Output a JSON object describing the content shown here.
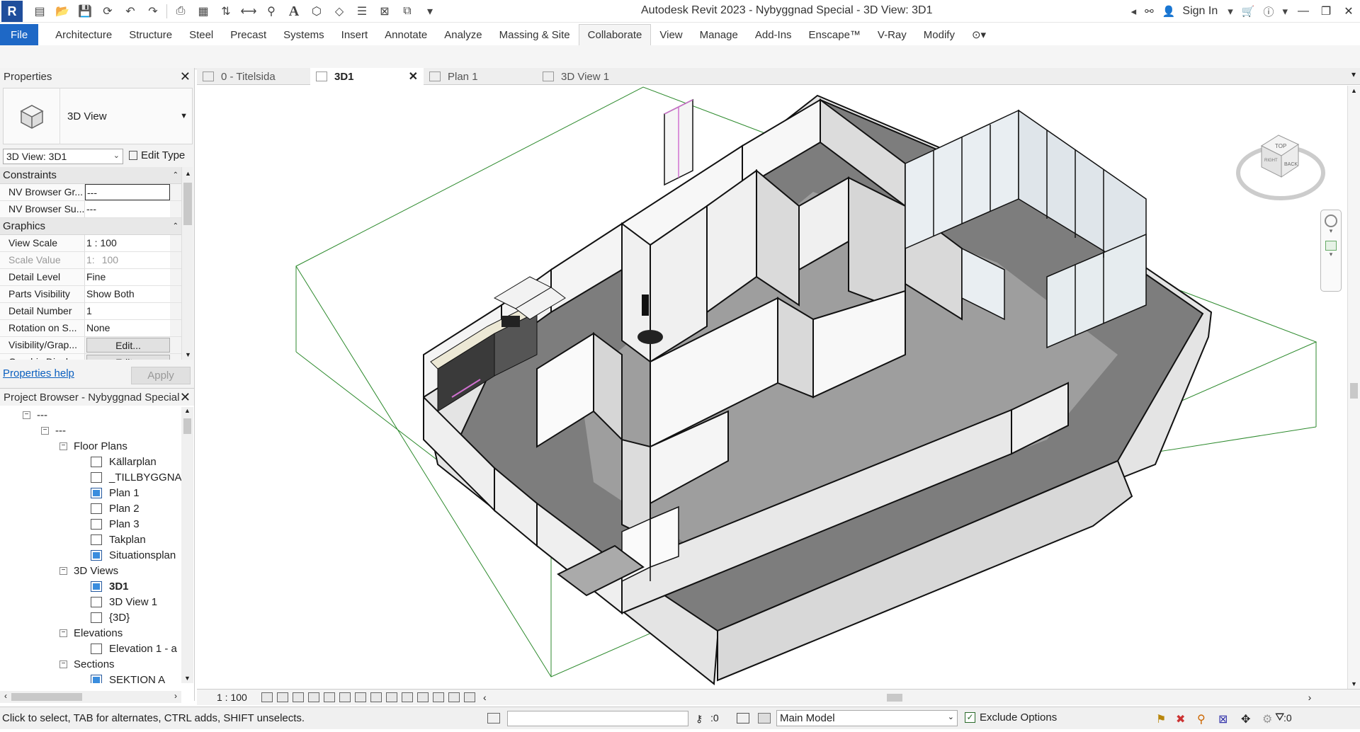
{
  "app": {
    "window_title": "Autodesk Revit 2023 - Nybyggnad Special - 3D View: 3D1",
    "logo_letter": "R",
    "sign_in": "Sign In"
  },
  "ribbon": {
    "tabs": [
      "File",
      "Architecture",
      "Structure",
      "Steel",
      "Precast",
      "Systems",
      "Insert",
      "Annotate",
      "Analyze",
      "Massing & Site",
      "Collaborate",
      "View",
      "Manage",
      "Add-Ins",
      "Enscape™",
      "V-Ray",
      "Modify"
    ],
    "active_tab": "Collaborate"
  },
  "properties": {
    "title": "Properties",
    "type_name": "3D View",
    "view_selector": "3D View: 3D1",
    "edit_type": "Edit Type",
    "sections": [
      {
        "name": "Constraints",
        "rows": [
          {
            "label": "NV Browser Gr...",
            "value": "---"
          },
          {
            "label": "NV Browser Su...",
            "value": "---"
          }
        ]
      },
      {
        "name": "Graphics",
        "rows": [
          {
            "label": "View Scale",
            "value": "1 : 100"
          },
          {
            "label": "Scale Value",
            "prefix": "1:",
            "value": "100"
          },
          {
            "label": "Detail Level",
            "value": "Fine"
          },
          {
            "label": "Parts Visibility",
            "value": "Show Both"
          },
          {
            "label": "Detail Number",
            "value": "1"
          },
          {
            "label": "Rotation on S...",
            "value": "None"
          },
          {
            "label": "Visibility/Grap...",
            "value": "Edit..."
          },
          {
            "label": "Graphic Displa...",
            "value": "Edit..."
          }
        ]
      }
    ],
    "help_link": "Properties help",
    "apply": "Apply"
  },
  "project_browser": {
    "title": "Project Browser - Nybyggnad Special",
    "nodes": [
      {
        "label": "---",
        "level": 0,
        "type": "group"
      },
      {
        "label": "---",
        "level": 1,
        "type": "group"
      },
      {
        "label": "Floor Plans",
        "level": 2,
        "type": "group"
      },
      {
        "label": "Källarplan",
        "level": 3,
        "type": "view",
        "filled": false
      },
      {
        "label": "_TILLBYGGNAD",
        "level": 3,
        "type": "view",
        "filled": false
      },
      {
        "label": "Plan 1",
        "level": 3,
        "type": "view",
        "filled": true
      },
      {
        "label": "Plan 2",
        "level": 3,
        "type": "view",
        "filled": false
      },
      {
        "label": "Plan 3",
        "level": 3,
        "type": "view",
        "filled": false
      },
      {
        "label": "Takplan",
        "level": 3,
        "type": "view",
        "filled": false
      },
      {
        "label": "Situationsplan",
        "level": 3,
        "type": "view",
        "filled": true
      },
      {
        "label": "3D Views",
        "level": 2,
        "type": "group"
      },
      {
        "label": "3D1",
        "level": 3,
        "type": "view",
        "filled": true,
        "bold": true
      },
      {
        "label": "3D View 1",
        "level": 3,
        "type": "view",
        "filled": false
      },
      {
        "label": "{3D}",
        "level": 3,
        "type": "view",
        "filled": false
      },
      {
        "label": "Elevations",
        "level": 2,
        "type": "group"
      },
      {
        "label": "Elevation 1 - a",
        "level": 3,
        "type": "view",
        "filled": false
      },
      {
        "label": "Sections",
        "level": 2,
        "type": "group"
      },
      {
        "label": "SEKTION A",
        "level": 3,
        "type": "view",
        "filled": true
      }
    ]
  },
  "doc_tabs": [
    {
      "label": "0 - Titelsida",
      "active": false
    },
    {
      "label": "3D1",
      "active": true
    },
    {
      "label": "Plan 1",
      "active": false
    },
    {
      "label": "3D View 1",
      "active": false
    }
  ],
  "view_control_bar": {
    "scale": "1 : 100"
  },
  "viewcube": {
    "top": "TOP",
    "back": "BACK",
    "right": "RIGHT"
  },
  "status": {
    "hint": "Click to select, TAB for alternates, CTRL adds, SHIFT unselects.",
    "edit_count": ":0",
    "model": "Main Model",
    "exclude_options": "Exclude Options",
    "filter_count": ":0"
  }
}
